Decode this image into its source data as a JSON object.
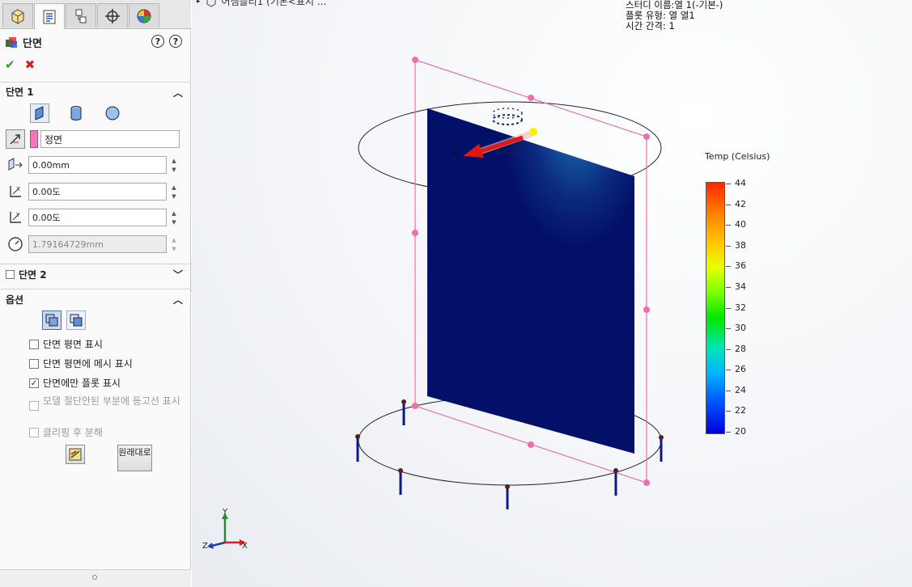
{
  "panel": {
    "title": "단면",
    "ok_symbol": "✔",
    "cancel_symbol": "✖",
    "section1": {
      "header": "단면 1",
      "reference_plane": "정면",
      "offset": "0.00mm",
      "rotate_x": "0.00도",
      "rotate_y": "0.00도",
      "thickness": "1.79164729mm"
    },
    "section2": {
      "header": "단면 2"
    },
    "options": {
      "header": "옵션",
      "checkboxes": [
        {
          "label": "단면 평면 표시",
          "checked": false,
          "enabled": true
        },
        {
          "label": "단면 평면에 메시 표시",
          "checked": false,
          "enabled": true
        },
        {
          "label": "단면에만 플롯 표시",
          "checked": true,
          "enabled": true
        },
        {
          "label": "모델 절단안된 부분에 등고선 표시",
          "checked": false,
          "enabled": false
        },
        {
          "label": "클리핑 후 분해",
          "checked": false,
          "enabled": false
        }
      ],
      "restore_button": "원래대로"
    },
    "help_labels": [
      "?",
      "?"
    ]
  },
  "viewport": {
    "tree_flyout": "어셈블리1 (기본<표시 ...",
    "study_info": [
      "스터디 이름:열 1(-기본-)",
      "플롯 유형: 열 열1",
      "시간 간격: 1"
    ],
    "triad": {
      "x": "X",
      "y": "Y",
      "z": "Z"
    },
    "sketch_axis_label": "X"
  },
  "legend": {
    "title": "Temp (Celsius)",
    "ticks": [
      "44",
      "42",
      "40",
      "38",
      "36",
      "34",
      "32",
      "30",
      "28",
      "26",
      "24",
      "22",
      "20"
    ]
  },
  "colors": {
    "section_face": "#0b1a6e",
    "bounding_plane": "#ee6fb0",
    "accent_blue": "#1a4fa0"
  }
}
